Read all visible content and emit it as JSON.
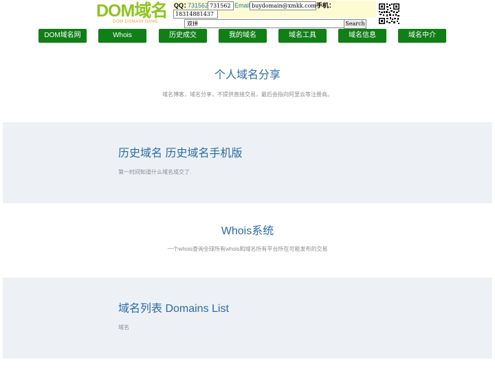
{
  "header": {
    "logo": {
      "main": "DOM域名",
      "sub": "DOM DOMAIN NAME"
    },
    "contact": {
      "qq_label": "QQ：",
      "qq_link": "731562",
      "qq_value": "731562",
      "email_label": "Email:",
      "email_value": "buydomain@xmkk.com",
      "phone_label": "手机：",
      "phone_value": "18314881437"
    },
    "search": {
      "value": "双拼",
      "button_label": "Search"
    },
    "qr_icon": "qr-code-icon"
  },
  "nav": {
    "items": [
      {
        "label": "DOM域名网"
      },
      {
        "label": "Whois"
      },
      {
        "label": "历史成交"
      },
      {
        "label": "我的域名"
      },
      {
        "label": "域名工具"
      },
      {
        "label": "域名信息"
      },
      {
        "label": "域名中介"
      }
    ]
  },
  "sections": [
    {
      "title": "个人域名分享",
      "description": "域名博客，域名分享，不提供直接交易，最后会指向阿里云等注册商。"
    },
    {
      "title": "历史域名 历史域名手机版",
      "description": "第一时间知道什么域名成交了."
    },
    {
      "title": "Whois系统",
      "description": "一个whois查询全球所有whois和域名所有平台所在可能发布的交易"
    },
    {
      "title": "域名列表 Domains List",
      "description": "域名"
    }
  ],
  "colors": {
    "nav_green": "#0f7f16",
    "logo_green": "#8fc31f",
    "title_blue": "#2b6aa3",
    "section_grey": "#edf1f5",
    "contact_bg": "#fdfbd2"
  }
}
